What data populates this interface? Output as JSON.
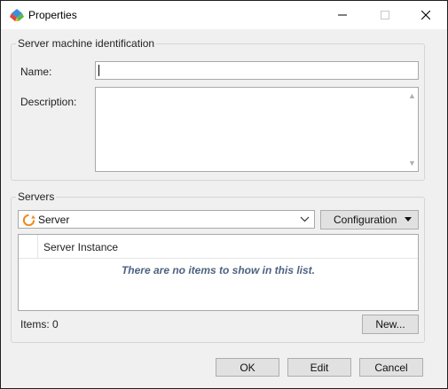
{
  "window": {
    "title": "Properties",
    "icon": "app-icon",
    "controls": [
      "minimize-icon",
      "maximize-icon",
      "close-icon"
    ]
  },
  "identification": {
    "legend": "Server machine identification",
    "name_label": "Name:",
    "name_value": "",
    "description_label": "Description:",
    "description_value": ""
  },
  "servers": {
    "legend": "Servers",
    "selected_server": "Server",
    "configuration_label": "Configuration",
    "list": {
      "columns": [
        "Server Instance"
      ],
      "rows": [],
      "empty_message": "There are no items to show in this list."
    },
    "items_count": "Items: 0",
    "new_label": "New..."
  },
  "footer": {
    "ok_label": "OK",
    "edit_label": "Edit",
    "cancel_label": "Cancel"
  },
  "colors": {
    "window_bg": "#f0f0f0",
    "empty_text": "#4d6382",
    "button_bg": "#e1e1e1"
  }
}
